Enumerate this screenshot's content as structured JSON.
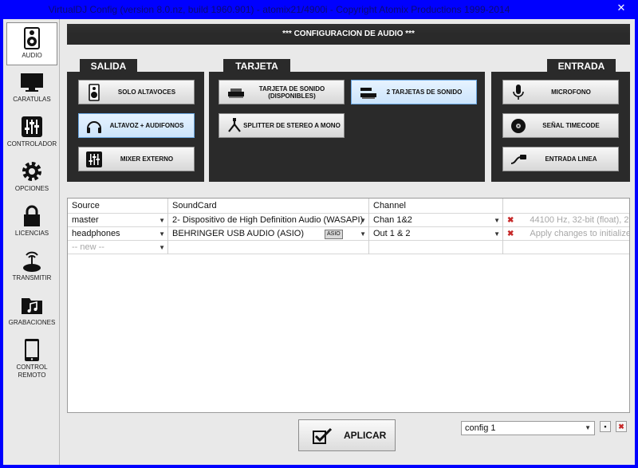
{
  "window": {
    "title": "VirtualDJ Config (version 8.0.nz, build 1960.901) - atomix21/4900i - Copyright Atomix Productions 1999-2014",
    "close_label": "✕"
  },
  "sidebar": {
    "items": [
      {
        "label": "AUDIO",
        "icon": "speaker-icon",
        "active": true
      },
      {
        "label": "CARATULAS",
        "icon": "monitor-icon"
      },
      {
        "label": "CONTROLADOR",
        "icon": "sliders-icon"
      },
      {
        "label": "OPCIONES",
        "icon": "gear-icon"
      },
      {
        "label": "LICENCIAS",
        "icon": "lock-icon"
      },
      {
        "label": "TRANSMITIR",
        "icon": "broadcast-icon"
      },
      {
        "label": "GRABACIONES",
        "icon": "folder-music-icon"
      },
      {
        "label": "CONTROL REMOTO",
        "icon": "tablet-icon"
      }
    ]
  },
  "header": {
    "title": "*** CONFIGURACION DE AUDIO ***"
  },
  "tabs": {
    "salida": "SALIDA",
    "tarjeta": "TARJETA",
    "entrada": "ENTRADA"
  },
  "salida": {
    "solo": "SOLO ALTAVOCES",
    "altavoz": "ALTAVOZ + AUDIFONOS",
    "mixer": "MIXER EXTERNO"
  },
  "tarjeta": {
    "disponibles": "TARJETA DE SONIDO (DISPONIBLES)",
    "dos": "2 TARJETAS DE SONIDO",
    "splitter": "SPLITTER DE STEREO A MONO"
  },
  "entrada": {
    "microfono": "MICROFONO",
    "timecode": "SEÑAL TIMECODE",
    "linea": "ENTRADA LINEA"
  },
  "table": {
    "headers": [
      "Source",
      "SoundCard",
      "Channel",
      ""
    ],
    "rows": [
      {
        "source": "master",
        "soundcard": "2- Dispositivo de High Definition Audio (WASAPI)",
        "asio": "",
        "channel": "Chan 1&2",
        "info": "44100 Hz, 32-bit (float), 2"
      },
      {
        "source": "headphones",
        "soundcard": "BEHRINGER USB AUDIO (ASIO)",
        "asio": "ASIO",
        "channel": "Out 1 & 2",
        "info": "Apply changes to initialize"
      }
    ],
    "new_row": "-- new --"
  },
  "apply": {
    "label": "APLICAR"
  },
  "config": {
    "selected": "config 1"
  },
  "colors": {
    "accent": "#0000ff",
    "panel": "#2a2a2a",
    "selected": "#cce4fb"
  }
}
